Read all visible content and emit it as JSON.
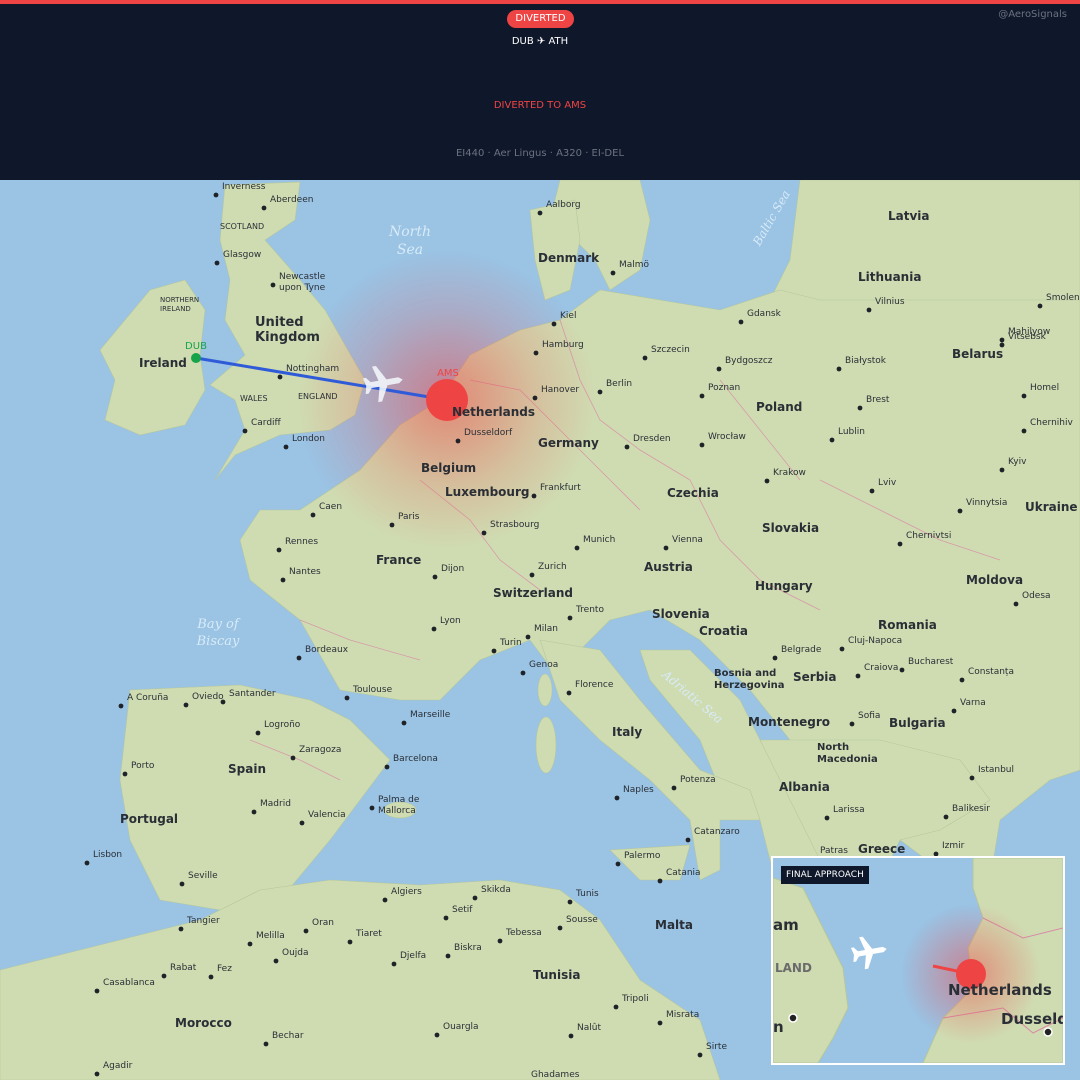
{
  "header": {
    "badge": "DIVERTED",
    "watermark": "@AeroSignals",
    "route": "DUB ✈ ATH",
    "status": "DIVERTED TO AMS",
    "flight_info": "EI440 · Aer Lingus · A320 · EI-DEL"
  },
  "colors": {
    "accent": "#ef4444",
    "route_line": "#2f5bd9",
    "origin_dot": "#16a34a",
    "header_bg": "#0f172a",
    "water": "#9ac3e4",
    "land": "#cfdcb2"
  },
  "map": {
    "origin_code": "DUB",
    "diversion_code": "AMS",
    "seas": [
      {
        "name": "North Sea"
      },
      {
        "name": "Bay of Biscay"
      },
      {
        "name": "Baltic Sea"
      },
      {
        "name": "Adriatic Sea"
      }
    ],
    "countries": [
      "Ireland",
      "United Kingdom",
      "Denmark",
      "Latvia",
      "Lithuania",
      "Belarus",
      "Poland",
      "Germany",
      "Netherlands",
      "Belgium",
      "Luxembourg",
      "France",
      "Czechia",
      "Slovakia",
      "Austria",
      "Switzerland",
      "Hungary",
      "Slovenia",
      "Croatia",
      "Romania",
      "Moldova",
      "Ukraine",
      "Bosnia and Herzegovina",
      "Serbia",
      "Montenegro",
      "Bulgaria",
      "North Macedonia",
      "Albania",
      "Greece",
      "Italy",
      "Spain",
      "Portugal",
      "Morocco",
      "Tunisia",
      "Malta"
    ],
    "regions": [
      "SCOTLAND",
      "NORTHERN IRELAND",
      "WALES",
      "ENGLAND"
    ],
    "cities": [
      "Inverness",
      "Aberdeen",
      "Glasgow",
      "Newcastle upon Tyne",
      "Nottingham",
      "Cardiff",
      "London",
      "Aalborg",
      "Malmö",
      "Kiel",
      "Hamburg",
      "Hanover",
      "Berlin",
      "Dusseldorf",
      "Szczecin",
      "Gdansk",
      "Bydgoszcz",
      "Poznan",
      "Białystok",
      "Vilnius",
      "Vitsebsk",
      "Smolen",
      "Mahilyow",
      "Homel",
      "Brest",
      "Lublin",
      "Wrocław",
      "Dresden",
      "Frankfurt",
      "Krakow",
      "Lviv",
      "Kyiv",
      "Chernihiv",
      "Vinnytsia",
      "Chernivtsi",
      "Odesa",
      "Caen",
      "Paris",
      "Rennes",
      "Nantes",
      "Dijon",
      "Strasbourg",
      "Munich",
      "Vienna",
      "Zurich",
      "Trento",
      "Lyon",
      "Milan",
      "Turin",
      "Genoa",
      "Bordeaux",
      "Toulouse",
      "Marseille",
      "Florence",
      "Cluj-Napoca",
      "Belgrade",
      "Craiova",
      "Bucharest",
      "Constanța",
      "Varna",
      "Sofia",
      "Istanbul",
      "Balikesir",
      "Izmir",
      "Larissa",
      "Patras",
      "A Coruña",
      "Oviedo",
      "Santander",
      "Logroño",
      "Zaragoza",
      "Barcelona",
      "Porto",
      "Madrid",
      "Valencia",
      "Palma de Mallorca",
      "Lisbon",
      "Seville",
      "Naples",
      "Potenza",
      "Catanzaro",
      "Palermo",
      "Catania",
      "Algiers",
      "Skikda",
      "Setif",
      "Tunis",
      "Sousse",
      "Oran",
      "Tiaret",
      "Melilla",
      "Oujda",
      "Djelfa",
      "Biskra",
      "Tebessa",
      "Tangier",
      "Rabat",
      "Fez",
      "Casablanca",
      "Tripoli",
      "Misrata",
      "Sirte",
      "Ouargla",
      "Nalût",
      "Bechar",
      "Ghadames",
      "Agadir"
    ]
  },
  "inset": {
    "title": "FINAL APPROACH",
    "labels": [
      "Netherlands",
      "Dusseld",
      "LAND",
      "am",
      "n"
    ]
  }
}
